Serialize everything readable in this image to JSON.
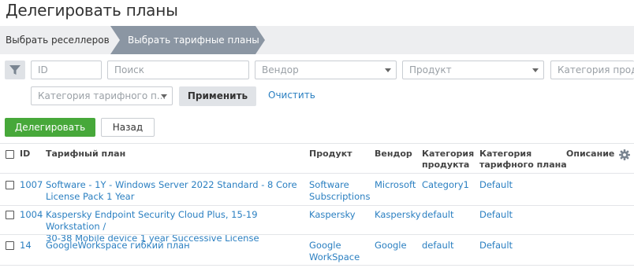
{
  "page": {
    "title": "Делегировать планы"
  },
  "wizard": {
    "steps": [
      {
        "label": "Выбрать реселлеров"
      },
      {
        "label": "Выбрать тарифные планы"
      }
    ],
    "active_color": "#8b96a3"
  },
  "filters": {
    "id_placeholder": "ID",
    "search_placeholder": "Поиск",
    "vendor_placeholder": "Вендор",
    "product_placeholder": "Продукт",
    "product_category_placeholder": "Категория продукта",
    "plan_category_placeholder": "Категория тарифного п...",
    "apply_label": "Применить",
    "clear_label": "Очистить",
    "filter_icon": "funnel-icon"
  },
  "actions": {
    "delegate_label": "Делегировать",
    "back_label": "Назад"
  },
  "table": {
    "headers": {
      "id": "ID",
      "plan": "Тарифный план",
      "product": "Продукт",
      "vendor": "Вендор",
      "product_category_1": "Категория",
      "product_category_2": "продукта",
      "plan_category_1": "Категория",
      "plan_category_2": "тарифного плана",
      "description": "Описание"
    },
    "rows": [
      {
        "id": "1007",
        "plan_1": "Software - 1Y - Windows Server 2022 Standard - 8 Core",
        "plan_2": "License Pack 1 Year",
        "product_1": "Software",
        "product_2": "Subscriptions",
        "vendor": "Microsoft",
        "product_category": "Category1",
        "plan_category": "Default"
      },
      {
        "id": "1004",
        "plan_1": "Kaspersky Endpoint Security Cloud Plus, 15-19 Workstation /",
        "plan_2": "30-38 Mobile device 1 year Successive License",
        "product_1": "Kaspersky",
        "product_2": "",
        "vendor": "Kaspersky",
        "product_category": "default",
        "plan_category": "Default"
      },
      {
        "id": "14",
        "plan_1": "GoogleWorkspace гибкий план",
        "plan_2": "",
        "product_1": "Google",
        "product_2": "WorkSpace",
        "vendor": "Google",
        "product_category": "default",
        "plan_category": "Default"
      }
    ],
    "settings_icon": "gear-icon"
  },
  "colors": {
    "link": "#2a7fc1",
    "primary_button": "#47a83a",
    "wizard_bg": "#edeef0"
  }
}
